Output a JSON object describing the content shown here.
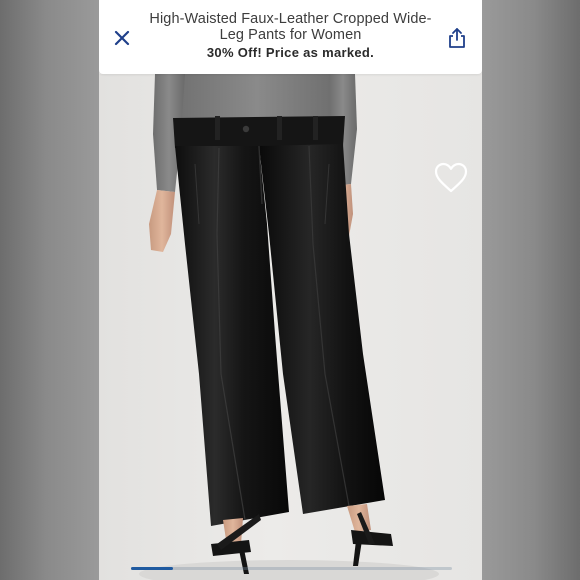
{
  "header": {
    "title": "High-Waisted Faux-Leather Cropped Wide-Leg Pants for Women",
    "promo": "30% Off! Price as marked.",
    "close_icon": "close-icon",
    "share_icon": "share-icon"
  },
  "image": {
    "favorite_icon": "heart-outline-icon"
  },
  "gallery": {
    "progress_fraction": 0.13
  },
  "colors": {
    "accent": "#1f5aa0",
    "title_text": "#3d3d3d"
  }
}
